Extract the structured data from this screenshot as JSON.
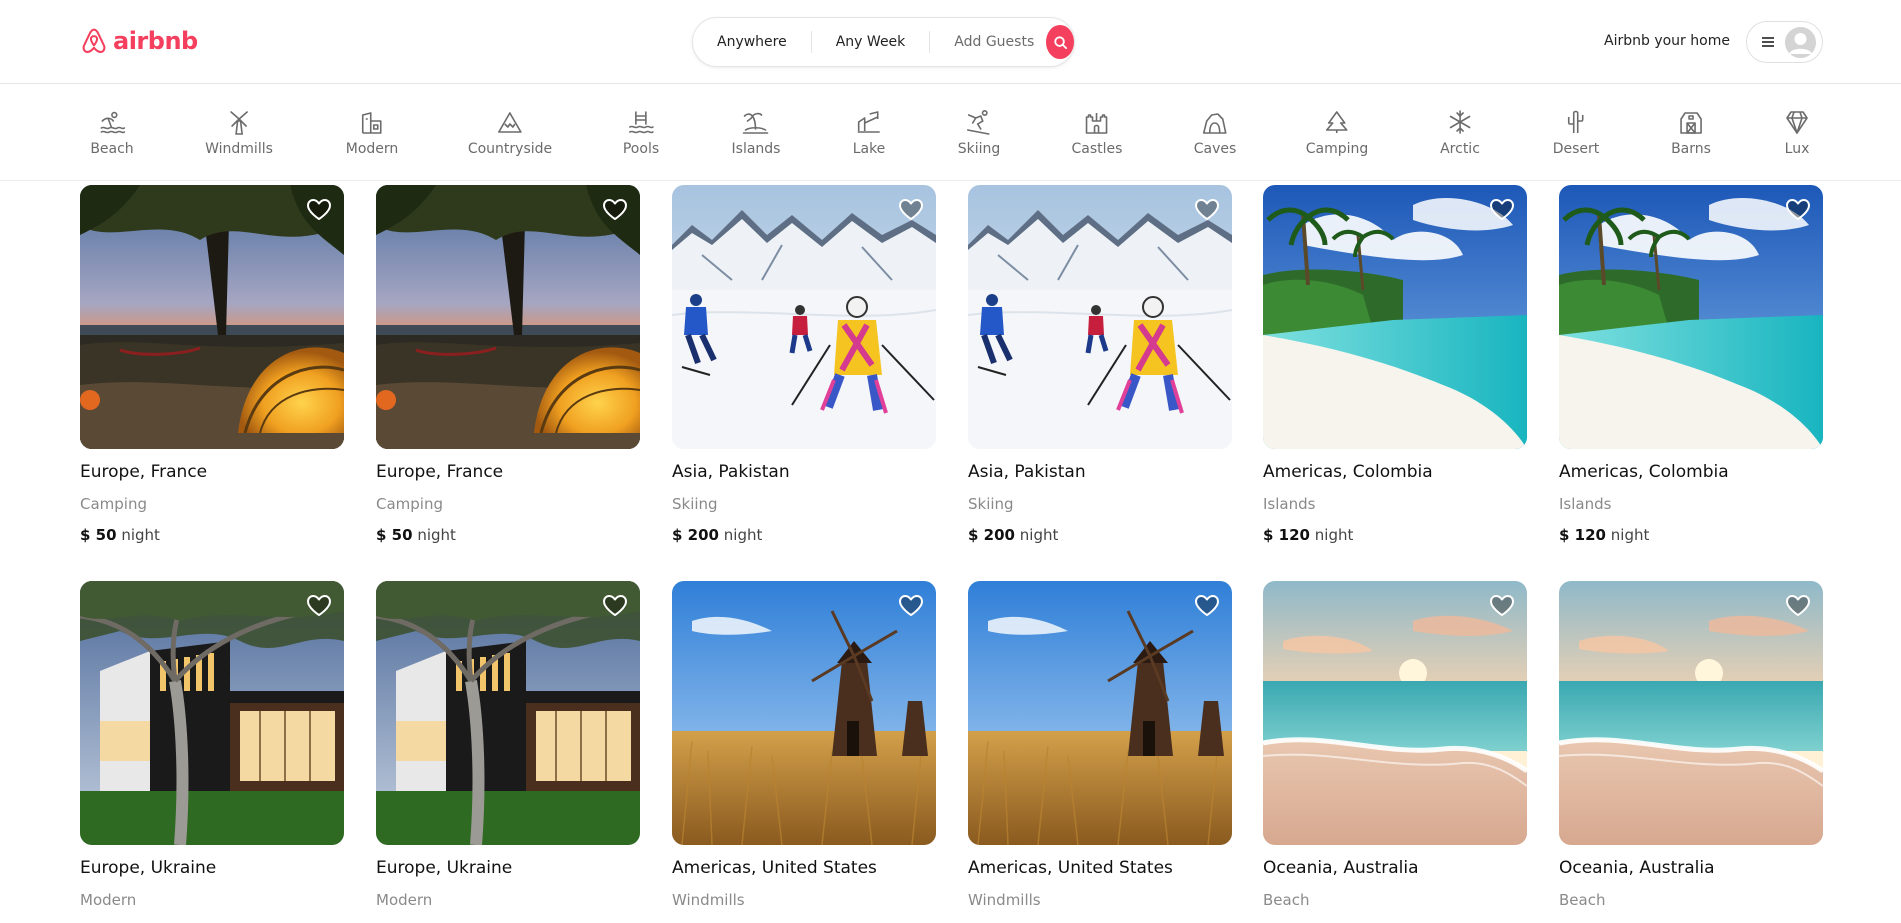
{
  "brand": {
    "name": "airbnb",
    "color": "#F43F5E"
  },
  "search": {
    "location": "Anywhere",
    "week": "Any Week",
    "guests": "Add Guests",
    "button_icon": "search-icon"
  },
  "header": {
    "host_link": "Airbnb your home",
    "menu_icon": "hamburger-icon",
    "avatar_icon": "user-avatar-icon"
  },
  "categories": [
    {
      "label": "Beach",
      "icon": "beach-icon"
    },
    {
      "label": "Windmills",
      "icon": "windmill-icon"
    },
    {
      "label": "Modern",
      "icon": "modern-icon"
    },
    {
      "label": "Countryside",
      "icon": "mountain-icon"
    },
    {
      "label": "Pools",
      "icon": "pool-icon"
    },
    {
      "label": "Islands",
      "icon": "island-icon"
    },
    {
      "label": "Lake",
      "icon": "boat-icon"
    },
    {
      "label": "Skiing",
      "icon": "skiing-icon"
    },
    {
      "label": "Castles",
      "icon": "castle-icon"
    },
    {
      "label": "Caves",
      "icon": "cave-icon"
    },
    {
      "label": "Camping",
      "icon": "camping-icon"
    },
    {
      "label": "Arctic",
      "icon": "snowflake-icon"
    },
    {
      "label": "Desert",
      "icon": "cactus-icon"
    },
    {
      "label": "Barns",
      "icon": "barn-icon"
    },
    {
      "label": "Lux",
      "icon": "diamond-icon"
    }
  ],
  "listings": [
    {
      "location": "Europe, France",
      "category": "Camping",
      "price": "$ 50",
      "unit": "night",
      "image": "camping"
    },
    {
      "location": "Europe, France",
      "category": "Camping",
      "price": "$ 50",
      "unit": "night",
      "image": "camping"
    },
    {
      "location": "Asia, Pakistan",
      "category": "Skiing",
      "price": "$ 200",
      "unit": "night",
      "image": "skiing"
    },
    {
      "location": "Asia, Pakistan",
      "category": "Skiing",
      "price": "$ 200",
      "unit": "night",
      "image": "skiing"
    },
    {
      "location": "Americas, Colombia",
      "category": "Islands",
      "price": "$ 120",
      "unit": "night",
      "image": "islands"
    },
    {
      "location": "Americas, Colombia",
      "category": "Islands",
      "price": "$ 120",
      "unit": "night",
      "image": "islands"
    },
    {
      "location": "Europe, Ukraine",
      "category": "Modern",
      "price": "",
      "unit": "",
      "image": "modern"
    },
    {
      "location": "Europe, Ukraine",
      "category": "Modern",
      "price": "",
      "unit": "",
      "image": "modern"
    },
    {
      "location": "Americas, United States",
      "category": "Windmills",
      "price": "",
      "unit": "",
      "image": "windmills"
    },
    {
      "location": "Americas, United States",
      "category": "Windmills",
      "price": "",
      "unit": "",
      "image": "windmills"
    },
    {
      "location": "Oceania, Australia",
      "category": "Beach",
      "price": "",
      "unit": "",
      "image": "beach"
    },
    {
      "location": "Oceania, Australia",
      "category": "Beach",
      "price": "",
      "unit": "",
      "image": "beach"
    }
  ]
}
